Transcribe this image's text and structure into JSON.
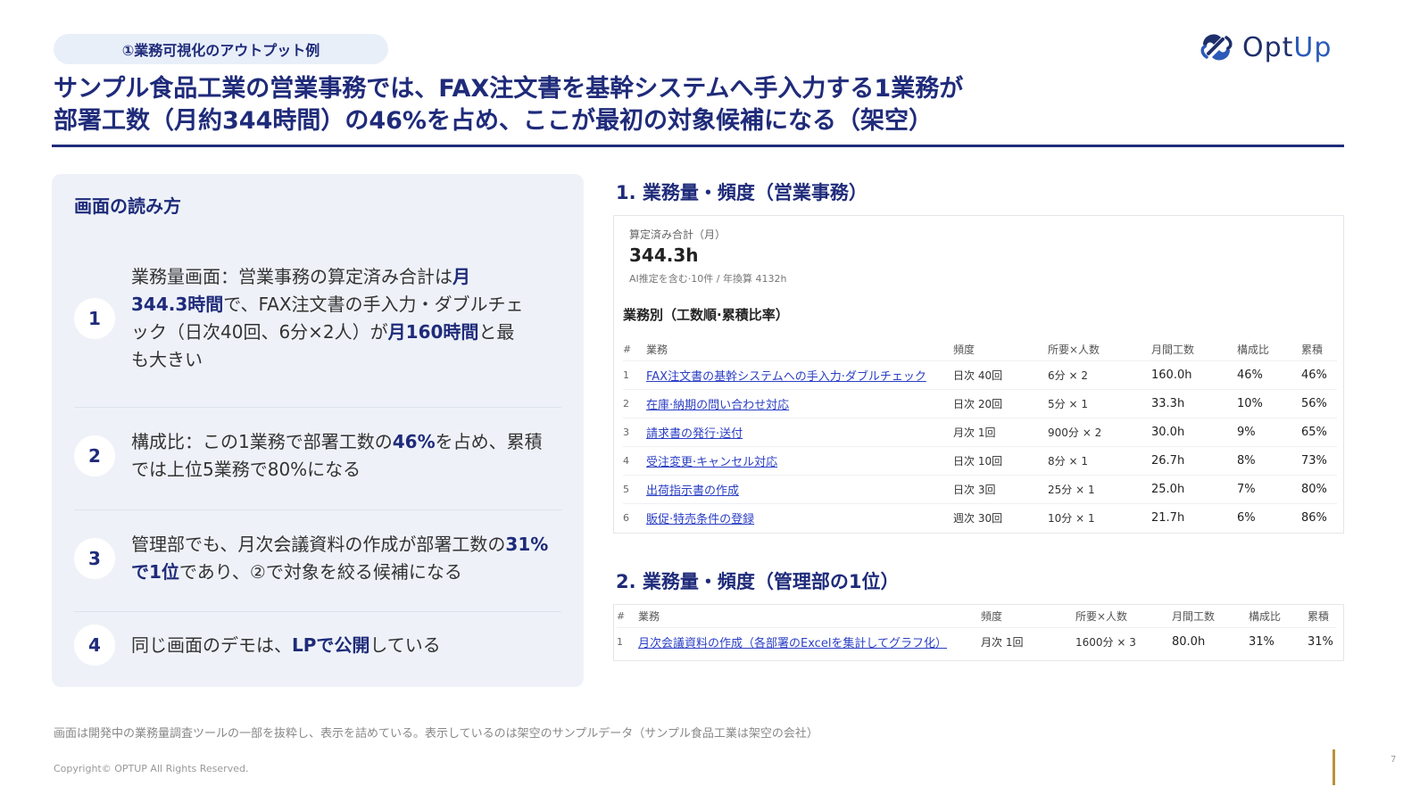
{
  "tag": "①業務可視化のアウトプット例",
  "logo": {
    "text_main": "Opt",
    "text_up": "Up",
    "icon": "optup-logo-icon",
    "brand_color": "#1f2f6b"
  },
  "headline": {
    "line1": "サンプル食品工業の営業事務では、FAX注文書を基幹システムへ手入力する1業務が",
    "line2": "部署工数（月約344時間）の46%を占め、ここが最初の対象候補になる（架空）"
  },
  "left_panel": {
    "title": "画面の読み方",
    "items": [
      {
        "num": "1",
        "parts": [
          {
            "t": "業務量画面：営業事務の算定済み合計は",
            "b": false
          },
          {
            "t": "月344.3時間",
            "b": true
          },
          {
            "t": "で、FAX注文書の手入力・ダブルチェック（日次40回、6分×2人）が",
            "b": false
          },
          {
            "t": "月160時間",
            "b": true
          },
          {
            "t": "と最も大きい",
            "b": false
          }
        ]
      },
      {
        "num": "2",
        "parts": [
          {
            "t": "構成比：この1業務で部署工数の",
            "b": false
          },
          {
            "t": "46%",
            "b": true
          },
          {
            "t": "を占め、累積では上位5業務で80%になる",
            "b": false
          }
        ]
      },
      {
        "num": "3",
        "parts": [
          {
            "t": "管理部でも、月次会議資料の作成が部署工数の",
            "b": false
          },
          {
            "t": "31%で1位",
            "b": true
          },
          {
            "t": "であり、②で対象を絞る候補になる",
            "b": false
          }
        ]
      },
      {
        "num": "4",
        "parts": [
          {
            "t": "同じ画面のデモは、",
            "b": false
          },
          {
            "t": "LPで公開",
            "b": true
          },
          {
            "t": "している",
            "b": false
          }
        ]
      }
    ]
  },
  "section1": {
    "title": "1. 業務量・頻度（営業事務）",
    "kpi_label": "算定済み合計（月）",
    "kpi_value": "344.3h",
    "kpi_note": "AI推定を含む·10件 / 年換算 4132h",
    "subhead": "業務別（工数順·累積比率）",
    "headers": [
      "#",
      "業務",
      "頻度",
      "所要×人数",
      "月間工数",
      "構成比",
      "累積"
    ],
    "rows": [
      [
        "1",
        "FAX注文書の基幹システムへの手入力·ダブルチェック",
        "日次 40回",
        "6分 × 2",
        "160.0h",
        "46%",
        "46%"
      ],
      [
        "2",
        "在庫·納期の問い合わせ対応",
        "日次 20回",
        "5分 × 1",
        "33.3h",
        "10%",
        "56%"
      ],
      [
        "3",
        "請求書の発行·送付",
        "月次 1回",
        "900分 × 2",
        "30.0h",
        "9%",
        "65%"
      ],
      [
        "4",
        "受注変更·キャンセル対応",
        "日次 10回",
        "8分 × 1",
        "26.7h",
        "8%",
        "73%"
      ],
      [
        "5",
        "出荷指示書の作成",
        "日次 3回",
        "25分 × 1",
        "25.0h",
        "7%",
        "80%"
      ],
      [
        "6",
        "販促·特売条件の登録",
        "週次 30回",
        "10分 × 1",
        "21.7h",
        "6%",
        "86%"
      ]
    ]
  },
  "section2": {
    "title": "2. 業務量・頻度（管理部の1位）",
    "headers": [
      "#",
      "業務",
      "頻度",
      "所要×人数",
      "月間工数",
      "構成比",
      "累積"
    ],
    "rows": [
      [
        "1",
        "月次会議資料の作成（各部署のExcelを集計してグラフ化）",
        "月次 1回",
        "1600分 × 3",
        "80.0h",
        "31%",
        "31%"
      ]
    ]
  },
  "footnote": "画面は開発中の業務量調査ツールの一部を抜粋し、表示を詰めている。表示しているのは架空のサンプルデータ（サンプル食品工業は架空の会社）",
  "copyright": "Copyright© OPTUP All Rights Reserved.",
  "page_number": "7"
}
